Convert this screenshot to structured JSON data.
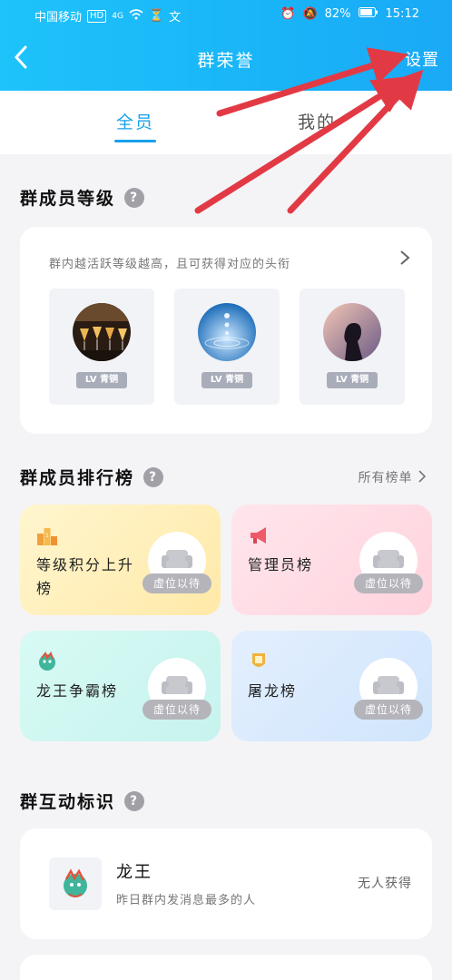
{
  "status": {
    "carrier": "中国移动",
    "hd": "HD",
    "network": "4G",
    "battery": "82%",
    "time": "15:12"
  },
  "header": {
    "title": "群荣誉",
    "settings_label": "设置"
  },
  "tabs": [
    {
      "label": "全员",
      "active": true
    },
    {
      "label": "我的",
      "active": false
    }
  ],
  "sections": {
    "levels_title": "群成员等级",
    "ranking_title": "群成员排行榜",
    "ranking_all": "所有榜单",
    "interaction_title": "群互动标识"
  },
  "levels": {
    "description": "群内越活跃等级越高，且可获得对应的头衔",
    "items": [
      {
        "tag": "LV 青铜",
        "avatar": "drinks-photo"
      },
      {
        "tag": "LV 青铜",
        "avatar": "water-drop-photo"
      },
      {
        "tag": "LV 青铜",
        "avatar": "silhouette-photo"
      }
    ]
  },
  "ranking": [
    {
      "label": "等级积分上升榜",
      "icon": "podium-icon",
      "seat": "虚位以待",
      "color": "#fff1c8"
    },
    {
      "label": "管理员榜",
      "icon": "megaphone-icon",
      "seat": "虚位以待",
      "color": "#ffdfe6"
    },
    {
      "label": "龙王争霸榜",
      "icon": "dragon-icon",
      "seat": "虚位以待",
      "color": "#d3f7f2"
    },
    {
      "label": "屠龙榜",
      "icon": "medal-icon",
      "seat": "虚位以待",
      "color": "#dbeafd"
    }
  ],
  "interaction": {
    "name": "龙王",
    "description": "昨日群内发消息最多的人",
    "status": "无人获得",
    "icon": "dragon-icon"
  },
  "colors": {
    "header": "#19b4f7",
    "accent": "#19a0e8",
    "annotation_arrow": "#e23a45"
  }
}
